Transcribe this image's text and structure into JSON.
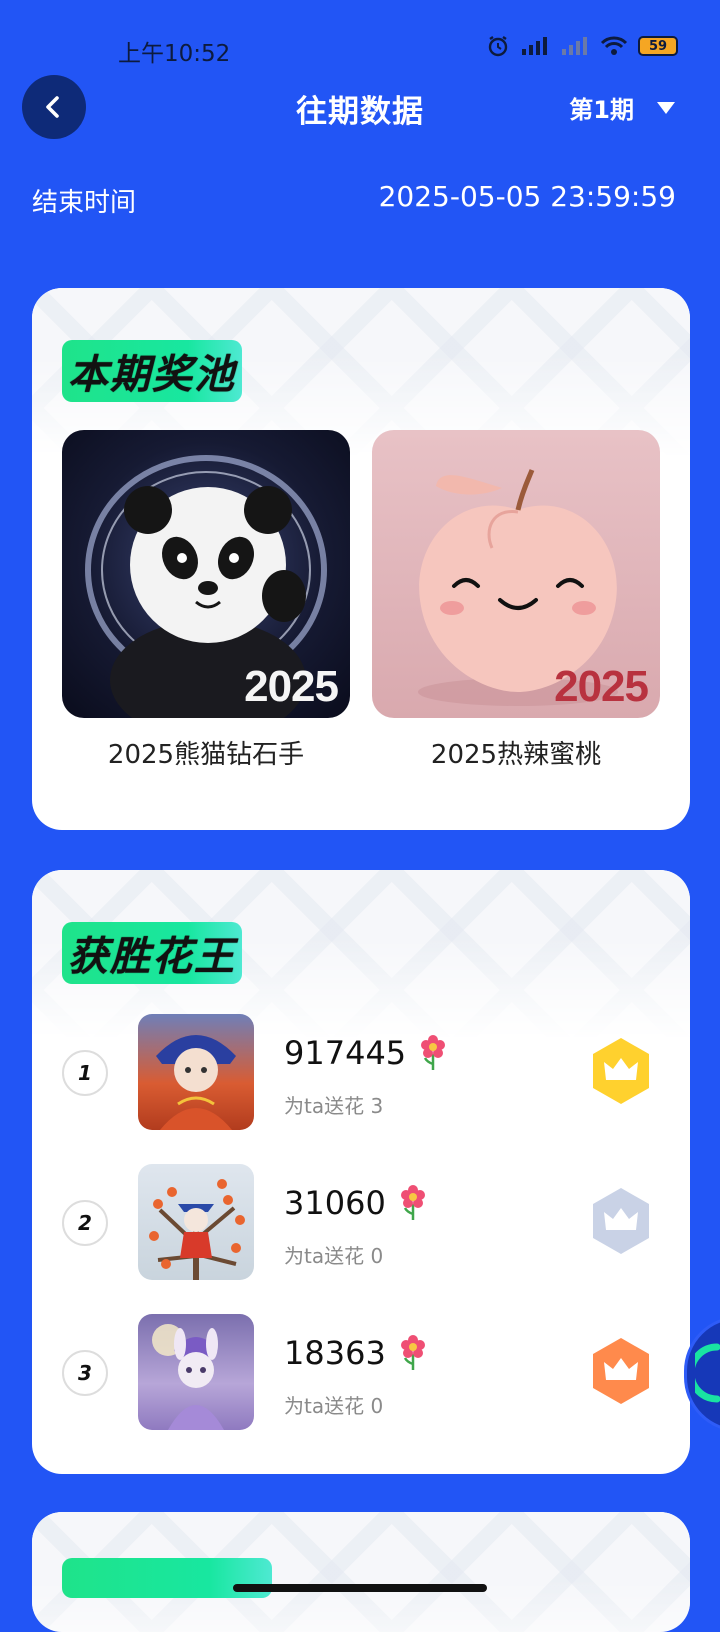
{
  "status": {
    "time": "上午10:52",
    "battery": "59"
  },
  "header": {
    "title": "往期数据",
    "period": "第1期"
  },
  "end_time": {
    "label": "结束时间",
    "value": "2025-05-05 23:59:59"
  },
  "prize_pool": {
    "title": "本期奖池",
    "items": [
      {
        "name": "2025熊猫钻石手",
        "year": "2025"
      },
      {
        "name": "2025热辣蜜桃",
        "year": "2025"
      }
    ]
  },
  "winners": {
    "title": "获胜花王",
    "items": [
      {
        "rank": "1",
        "score": "917445",
        "sub": "为ta送花 3",
        "crown": "gold"
      },
      {
        "rank": "2",
        "score": "31060",
        "sub": "为ta送花 0",
        "crown": "silver"
      },
      {
        "rank": "3",
        "score": "18363",
        "sub": "为ta送花 0",
        "crown": "bronze"
      }
    ]
  },
  "colors": {
    "background": "#2255F5",
    "gold": "#FFD12E",
    "silver": "#C9D2E6",
    "bronze": "#FF8A4C",
    "title_highlight": "#1FE38A"
  }
}
